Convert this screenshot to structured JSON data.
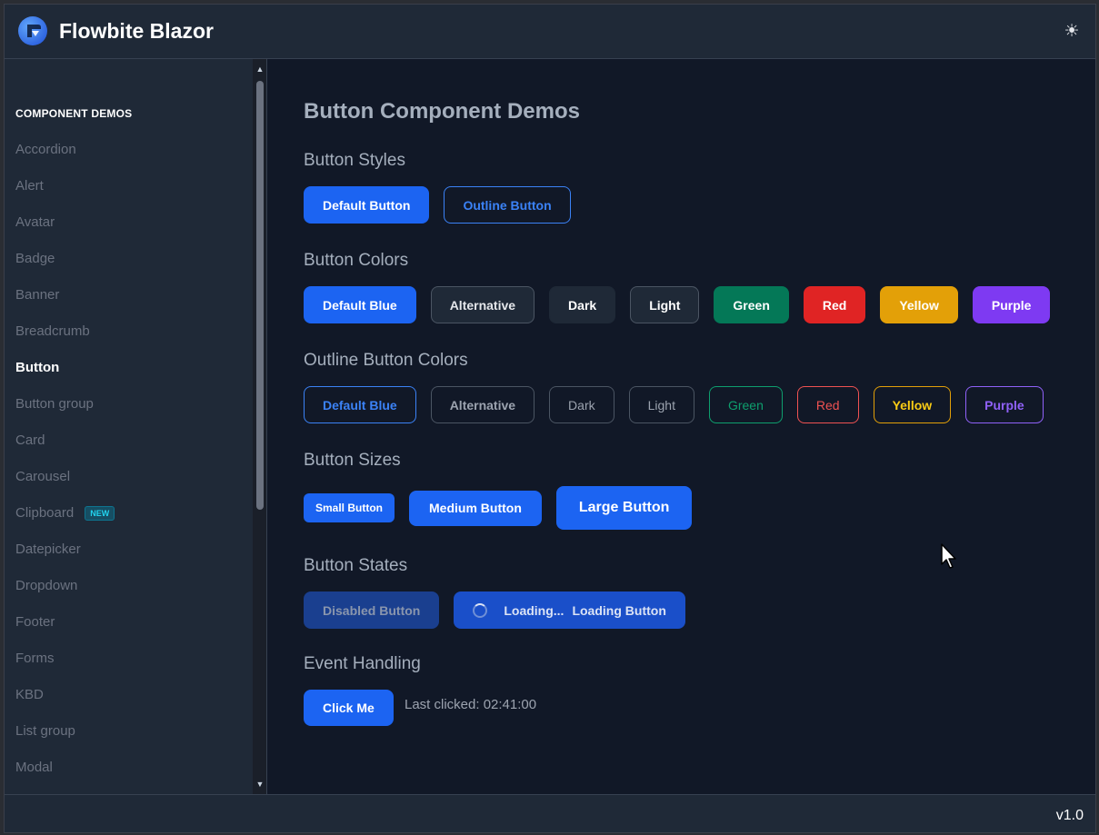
{
  "app": {
    "title": "Flowbite Blazor",
    "theme_icon": "sun-icon"
  },
  "sidebar": {
    "heading": "COMPONENT DEMOS",
    "items": [
      {
        "label": "Accordion",
        "active": false
      },
      {
        "label": "Alert",
        "active": false
      },
      {
        "label": "Avatar",
        "active": false
      },
      {
        "label": "Badge",
        "active": false
      },
      {
        "label": "Banner",
        "active": false
      },
      {
        "label": "Breadcrumb",
        "active": false
      },
      {
        "label": "Button",
        "active": true
      },
      {
        "label": "Button group",
        "active": false
      },
      {
        "label": "Card",
        "active": false
      },
      {
        "label": "Carousel",
        "active": false
      },
      {
        "label": "Clipboard",
        "active": false,
        "badge": "NEW"
      },
      {
        "label": "Datepicker",
        "active": false
      },
      {
        "label": "Dropdown",
        "active": false
      },
      {
        "label": "Footer",
        "active": false
      },
      {
        "label": "Forms",
        "active": false
      },
      {
        "label": "KBD",
        "active": false
      },
      {
        "label": "List group",
        "active": false
      },
      {
        "label": "Modal",
        "active": false
      }
    ]
  },
  "main": {
    "title": "Button Component Demos",
    "styles": {
      "title": "Button Styles",
      "default": "Default Button",
      "outline": "Outline Button"
    },
    "colors": {
      "title": "Button Colors",
      "buttons": [
        "Default Blue",
        "Alternative",
        "Dark",
        "Light",
        "Green",
        "Red",
        "Yellow",
        "Purple"
      ]
    },
    "outline_colors": {
      "title": "Outline Button Colors",
      "buttons": [
        "Default Blue",
        "Alternative",
        "Dark",
        "Light",
        "Green",
        "Red",
        "Yellow",
        "Purple"
      ]
    },
    "sizes": {
      "title": "Button Sizes",
      "small": "Small Button",
      "medium": "Medium Button",
      "large": "Large Button"
    },
    "states": {
      "title": "Button States",
      "disabled": "Disabled Button",
      "loading_text": "Loading...",
      "loading_label": "Loading Button"
    },
    "events": {
      "title": "Event Handling",
      "click_label": "Click Me",
      "last_clicked": "Last clicked: 02:41:00"
    }
  },
  "footer": {
    "version": "v1.0"
  }
}
